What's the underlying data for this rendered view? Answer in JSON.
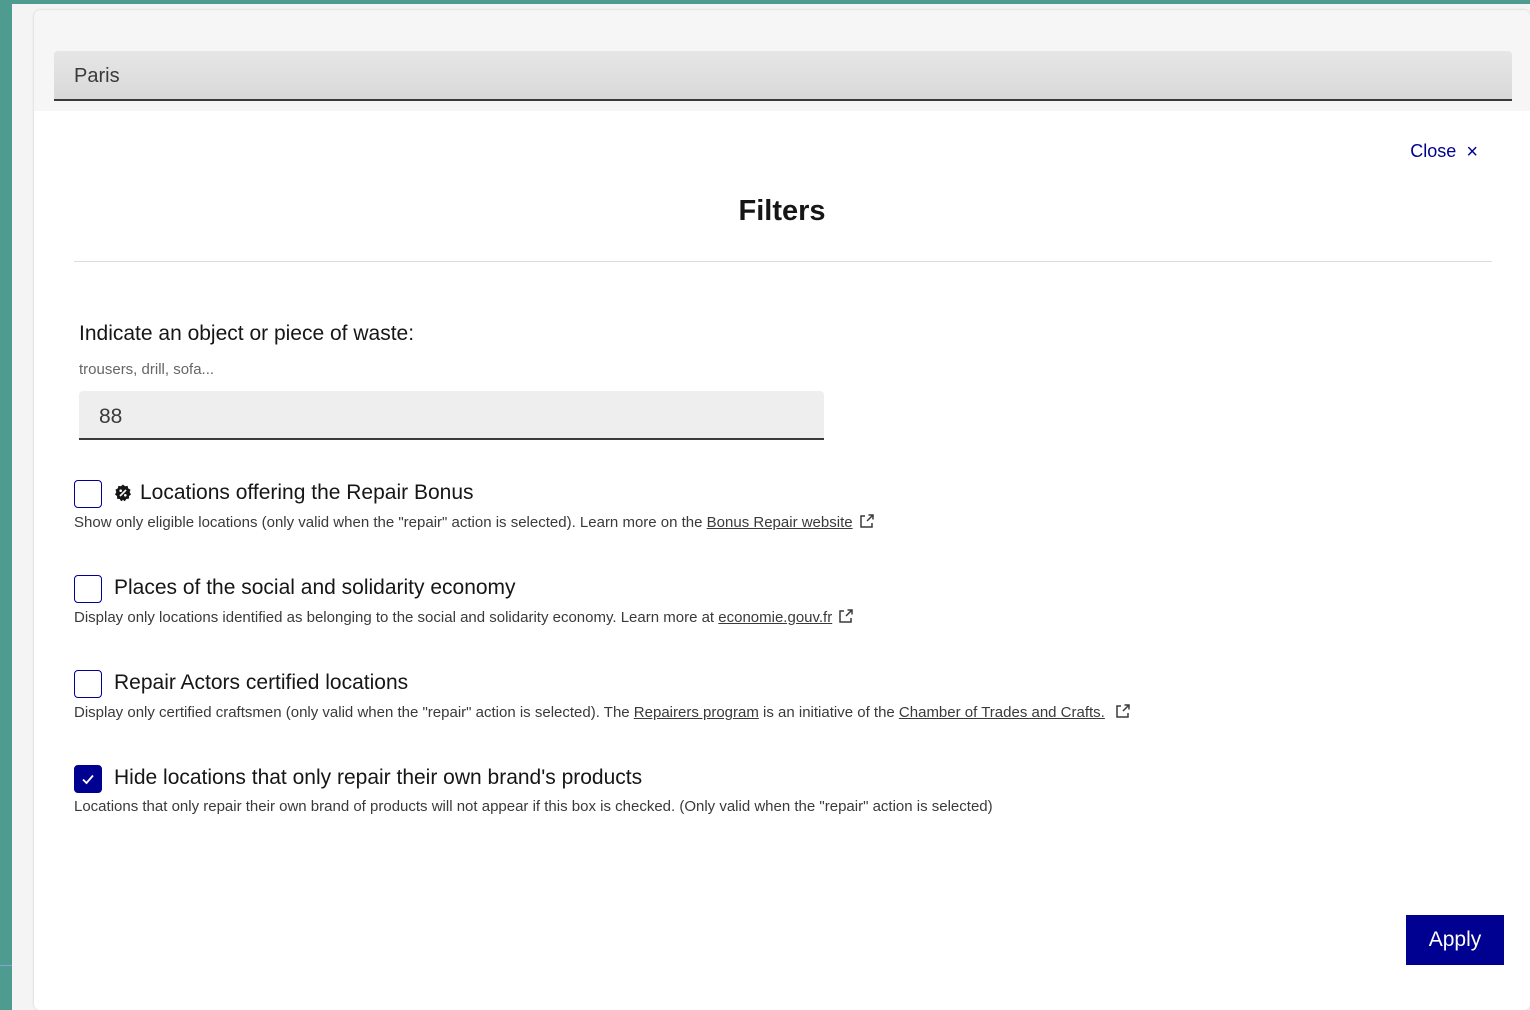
{
  "search": {
    "location_value": "Paris"
  },
  "modal": {
    "close_label": "Close",
    "close_icon": "×",
    "title": "Filters",
    "object_field": {
      "label": "Indicate an object or piece of waste:",
      "hint": "trousers, drill, sofa...",
      "value": "88"
    },
    "filters": [
      {
        "label": "Locations offering the Repair Bonus",
        "checked": false,
        "icon": "repair-bonus-badge-icon",
        "desc_before": "Show only eligible locations (only valid when the \"repair\" action is selected). Learn more on the ",
        "link": "Bonus Repair website"
      },
      {
        "label": "Places of the social and solidarity economy",
        "checked": false,
        "desc_before": "Display only locations identified as belonging to the social and solidarity economy. Learn more at ",
        "link": "economie.gouv.fr"
      },
      {
        "label": "Repair Actors certified locations",
        "checked": false,
        "desc_before": "Display only certified craftsmen (only valid when the \"repair\" action is selected). The ",
        "link1": "Repairers program",
        "desc_middle": " is an initiative of the ",
        "link2": "Chamber of Trades and Crafts."
      },
      {
        "label": "Hide locations that only repair their own brand's products",
        "checked": true,
        "desc": "Locations that only repair their own brand of products will not appear if this box is checked. (Only valid when the \"repair\" action is selected)"
      }
    ],
    "apply_label": "Apply"
  },
  "colors": {
    "accent": "#000091",
    "background": "#4e9c8f"
  }
}
